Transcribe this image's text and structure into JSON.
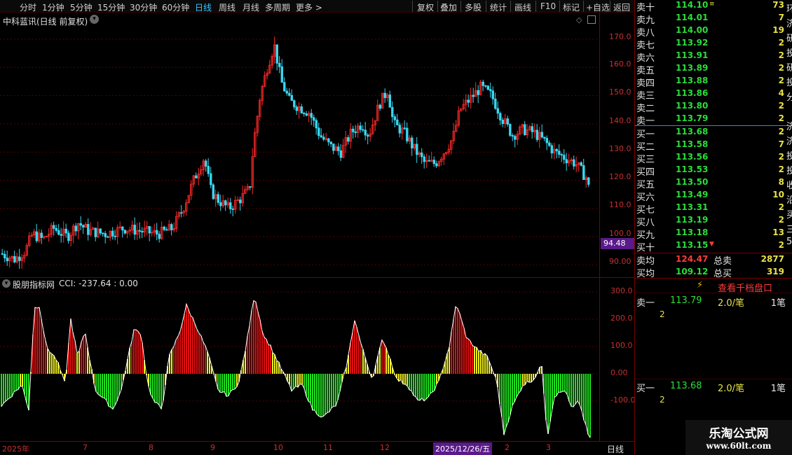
{
  "toolbar": {
    "periods": [
      "分时",
      "1分钟",
      "5分钟",
      "15分钟",
      "30分钟",
      "60分钟",
      "日线",
      "周线",
      "月线",
      "多周期",
      "更多 >"
    ],
    "active_period": "日线",
    "tools": [
      "复权",
      "叠加",
      "多股",
      "统计",
      "画线",
      "F10",
      "标记",
      "+自选",
      "返回"
    ]
  },
  "main_chart": {
    "title": "中科蓝讯(日线 前复权)",
    "price_ticks": [
      "170.0",
      "160.0",
      "150.0",
      "140.0",
      "130.0",
      "120.0",
      "110.0",
      "100.0",
      "90.00"
    ],
    "current_low_badge": "94.48",
    "colors": {
      "up": "#ff2a2a",
      "down": "#39d7f0",
      "grid": "#5a0000"
    }
  },
  "indicator": {
    "title": "股朋指标网",
    "readout": "CCI: -237.64 : 0.00",
    "ticks": [
      "300.0",
      "200.0",
      "100.0",
      "0.00",
      "-100.0"
    ],
    "colors": {
      "red": "#e01010",
      "yellow": "#f0f020",
      "green": "#20e020"
    }
  },
  "date_axis": {
    "labels": [
      "2025年",
      "7",
      "8",
      "9",
      "10",
      "11",
      "12",
      "2025/12/26/五",
      "2",
      "3"
    ],
    "highlight": "2025/12/26/五",
    "period_label": "日线"
  },
  "order_book": {
    "asks": [
      {
        "label": "卖十",
        "price": "114.10",
        "vol": "73",
        "mark": "≡"
      },
      {
        "label": "卖九",
        "price": "114.01",
        "vol": "7"
      },
      {
        "label": "卖八",
        "price": "114.00",
        "vol": "19"
      },
      {
        "label": "卖七",
        "price": "113.92",
        "vol": "2"
      },
      {
        "label": "卖六",
        "price": "113.91",
        "vol": "2"
      },
      {
        "label": "卖五",
        "price": "113.89",
        "vol": "2"
      },
      {
        "label": "卖四",
        "price": "113.88",
        "vol": "2"
      },
      {
        "label": "卖三",
        "price": "113.86",
        "vol": "4"
      },
      {
        "label": "卖二",
        "price": "113.80",
        "vol": "2"
      },
      {
        "label": "卖一",
        "price": "113.79",
        "vol": "2"
      }
    ],
    "bids": [
      {
        "label": "买一",
        "price": "113.68",
        "vol": "2"
      },
      {
        "label": "买二",
        "price": "113.58",
        "vol": "7"
      },
      {
        "label": "买三",
        "price": "113.56",
        "vol": "2"
      },
      {
        "label": "买四",
        "price": "113.53",
        "vol": "2"
      },
      {
        "label": "买五",
        "price": "113.50",
        "vol": "8"
      },
      {
        "label": "买六",
        "price": "113.49",
        "vol": "10"
      },
      {
        "label": "买七",
        "price": "113.31",
        "vol": "2"
      },
      {
        "label": "买八",
        "price": "113.19",
        "vol": "2"
      },
      {
        "label": "买九",
        "price": "113.18",
        "vol": "13"
      },
      {
        "label": "买十",
        "price": "113.15",
        "vol": "2",
        "mark": "▼"
      }
    ],
    "edge_chars": [
      "环",
      "济",
      "研",
      "投",
      "研",
      "投",
      "分",
      "",
      "济",
      "济",
      "投",
      "投",
      "收",
      "沿",
      "买",
      "三",
      "5"
    ],
    "summary": {
      "ask_avg_label": "卖均",
      "ask_avg": "124.47",
      "ask_total_label": "总卖",
      "ask_total": "2877",
      "bid_avg_label": "买均",
      "bid_avg": "109.12",
      "bid_total_label": "总买",
      "bid_total": "319"
    },
    "thousand_link": "查看千档盘口",
    "queue": {
      "ask_label": "卖一",
      "ask_price": "113.79",
      "ask_per": "2.0/笔",
      "ask_count": "1笔",
      "ask_queue": "2",
      "bid_label": "买一",
      "bid_price": "113.68",
      "bid_per": "2.0/笔",
      "bid_count": "1笔",
      "bid_queue": "2"
    }
  },
  "watermark": {
    "name": "乐淘公式网",
    "url": "www.60lt.com"
  }
}
